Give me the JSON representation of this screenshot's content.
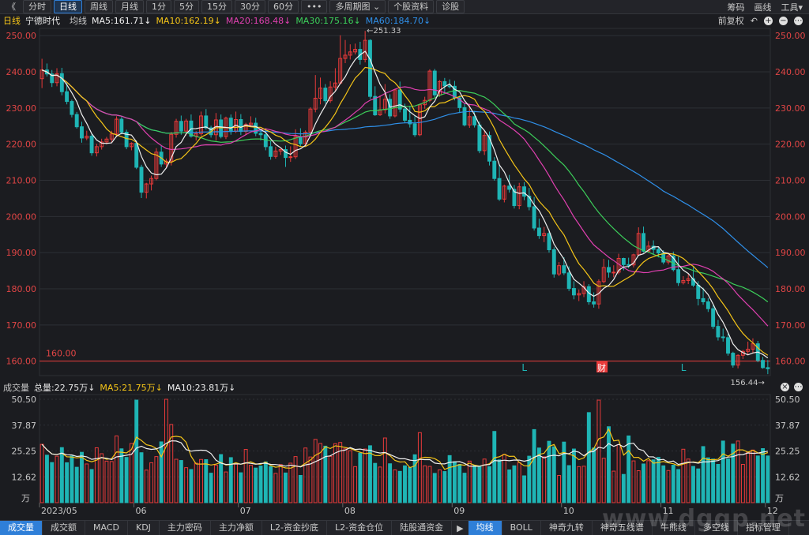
{
  "toolbar": {
    "back": "《",
    "buttons": [
      "分时",
      "日线",
      "周线",
      "月线",
      "1分",
      "5分",
      "15分",
      "30分",
      "60分",
      "•••",
      "多周期图 ⌄",
      "个股资料",
      "诊股"
    ],
    "active_index": 1,
    "right": [
      "筹码",
      "画线",
      "工具▾"
    ]
  },
  "legend": {
    "period": "日线",
    "stock": "宁德时代",
    "ma_label": "均线",
    "ma5": "MA5:161.71↓",
    "ma10": "MA10:162.19↓",
    "ma20": "MA20:168.48↓",
    "ma30": "MA30:175.16↓",
    "ma60": "MA60:184.70↓",
    "right_label": "前复权",
    "colors": {
      "ma5": "#f0f0f0",
      "ma10": "#f5c518",
      "ma20": "#e040b0",
      "ma30": "#3ccf5a",
      "ma60": "#2f8fe8"
    }
  },
  "volume_legend": {
    "label": "成交量",
    "total": "总量:22.75万↓",
    "ma5": "MA5:21.75万↓",
    "ma10": "MA10:23.81万↓"
  },
  "price_axis": {
    "labels": [
      "250.00",
      "240.00",
      "230.00",
      "220.00",
      "210.00",
      "200.00",
      "190.00",
      "180.00",
      "170.00",
      "160.00"
    ],
    "ref_line": "160.00",
    "high": "251.33",
    "low": "156.44"
  },
  "volume_axis": {
    "labels": [
      "50.50",
      "37.87",
      "25.25",
      "12.62",
      "万"
    ]
  },
  "markers": [
    "L",
    "财",
    "L"
  ],
  "x_labels": [
    "2023/05",
    "06",
    "07",
    "08",
    "09",
    "10",
    "11",
    "12"
  ],
  "bottom_tabs": [
    "成交量",
    "成交额",
    "MACD",
    "KDJ",
    "主力密码",
    "主力净额",
    "L2-资金抄底",
    "L2-资金仓位",
    "陆股通资金",
    "▶",
    "均线",
    "BOLL",
    "神奇九转",
    "神奇五线谱",
    "牛熊线",
    "多空线",
    "指标管理"
  ],
  "bottom_active": [
    0,
    10
  ],
  "watermark": "www.dgqp.net",
  "colors": {
    "up": "#e83a3a",
    "down": "#1fb5b5",
    "bg": "#1b1c20",
    "grid": "#2d2f35"
  },
  "chart_data": {
    "type": "candlestick",
    "title": "宁德时代 日线",
    "ylim": [
      156,
      252
    ],
    "volume_ylim": [
      0,
      50.5
    ],
    "candles": [
      [
        238.1,
        243.6,
        240.5,
        235.5,
        28.5
      ],
      [
        240.5,
        242.3,
        239.4,
        238.7,
        23.2
      ],
      [
        239.4,
        240.5,
        237.0,
        235.8,
        19.6
      ],
      [
        237.0,
        241.0,
        239.5,
        236.0,
        22.7
      ],
      [
        239.5,
        241.1,
        234.5,
        233.5,
        26.9
      ],
      [
        234.5,
        237.1,
        231.8,
        231.0,
        19.5
      ],
      [
        231.8,
        232.3,
        228.2,
        227.4,
        22.8
      ],
      [
        228.2,
        228.9,
        224.8,
        224.3,
        17.3
      ],
      [
        224.8,
        226.2,
        221.7,
        220.4,
        24.6
      ],
      [
        221.7,
        223.7,
        222.2,
        221.1,
        18.9
      ],
      [
        222.2,
        222.7,
        217.6,
        216.8,
        16.2
      ],
      [
        217.6,
        220.1,
        219.3,
        216.6,
        26.8
      ],
      [
        219.3,
        221.5,
        220.6,
        218.5,
        23.9
      ],
      [
        220.6,
        222.0,
        221.4,
        219.9,
        20.3
      ],
      [
        221.4,
        223.7,
        222.8,
        220.5,
        20.1
      ],
      [
        222.8,
        227.7,
        226.9,
        221.9,
        32.6
      ],
      [
        226.9,
        227.5,
        223.3,
        222.7,
        26.3
      ],
      [
        223.3,
        224.0,
        219.3,
        218.6,
        22.1
      ],
      [
        219.3,
        220.5,
        220.2,
        218.3,
        28.9
      ],
      [
        220.2,
        221.0,
        213.6,
        213.1,
        50.1
      ],
      [
        213.6,
        214.3,
        206.7,
        205.1,
        24.4
      ],
      [
        206.7,
        209.3,
        209.0,
        205.0,
        15.9
      ],
      [
        209.0,
        211.3,
        210.5,
        207.2,
        19.5
      ],
      [
        210.5,
        218.9,
        217.8,
        210.0,
        22.5
      ],
      [
        217.8,
        219.5,
        214.5,
        213.7,
        29.7
      ],
      [
        214.5,
        216.0,
        215.3,
        213.6,
        50.5
      ],
      [
        215.3,
        223.4,
        222.7,
        214.1,
        38.2
      ],
      [
        222.7,
        227.0,
        226.3,
        221.8,
        21.2
      ],
      [
        226.3,
        227.9,
        223.6,
        222.6,
        20.6
      ],
      [
        223.6,
        227.0,
        226.4,
        222.4,
        17.1
      ],
      [
        226.4,
        228.2,
        222.2,
        221.8,
        16.2
      ],
      [
        222.2,
        223.6,
        222.9,
        221.0,
        19.3
      ],
      [
        222.9,
        229.0,
        227.8,
        222.3,
        21.1
      ],
      [
        227.8,
        229.7,
        224.5,
        224.0,
        21.0
      ],
      [
        224.5,
        225.1,
        222.6,
        221.8,
        14.4
      ],
      [
        222.6,
        228.6,
        226.7,
        221.0,
        18.3
      ],
      [
        226.7,
        228.2,
        222.1,
        221.6,
        23.5
      ],
      [
        222.1,
        227.6,
        227.2,
        221.4,
        15.0
      ],
      [
        227.2,
        228.2,
        223.5,
        222.6,
        22.0
      ],
      [
        223.5,
        229.0,
        226.8,
        223.1,
        18.8
      ],
      [
        226.8,
        228.3,
        223.5,
        222.5,
        14.6
      ],
      [
        223.5,
        225.9,
        225.4,
        222.7,
        26.0
      ],
      [
        225.4,
        227.7,
        225.8,
        224.8,
        18.3
      ],
      [
        225.8,
        227.3,
        223.0,
        222.2,
        16.9
      ],
      [
        223.0,
        224.1,
        222.6,
        221.0,
        17.9
      ],
      [
        222.6,
        224.4,
        219.3,
        218.3,
        19.9
      ],
      [
        219.3,
        220.8,
        216.6,
        215.7,
        17.6
      ],
      [
        216.6,
        219.3,
        218.1,
        216.0,
        14.3
      ],
      [
        218.1,
        218.8,
        218.5,
        217.0,
        18.6
      ],
      [
        218.5,
        219.6,
        216.3,
        213.7,
        14.5
      ],
      [
        216.3,
        219.4,
        216.5,
        215.1,
        19.3
      ],
      [
        216.5,
        224.1,
        222.1,
        215.9,
        22.5
      ],
      [
        222.1,
        224.4,
        220.1,
        219.4,
        13.3
      ],
      [
        220.1,
        223.8,
        223.3,
        219.8,
        26.7
      ],
      [
        223.3,
        230.2,
        229.7,
        222.5,
        22.3
      ],
      [
        229.7,
        239.1,
        232.7,
        228.8,
        30.9
      ],
      [
        232.7,
        238.4,
        235.5,
        231.0,
        28.9
      ],
      [
        235.5,
        236.6,
        232.0,
        231.2,
        27.6
      ],
      [
        232.0,
        237.4,
        235.8,
        231.4,
        22.6
      ],
      [
        235.8,
        241.0,
        236.9,
        234.7,
        28.8
      ],
      [
        236.9,
        250.1,
        243.7,
        236.5,
        29.4
      ],
      [
        243.7,
        248.8,
        244.6,
        242.4,
        26.3
      ],
      [
        244.6,
        247.6,
        245.5,
        243.4,
        25.4
      ],
      [
        245.5,
        247.8,
        246.2,
        244.8,
        17.6
      ],
      [
        246.2,
        248.3,
        243.4,
        242.0,
        24.2
      ],
      [
        243.4,
        251.3,
        248.7,
        242.6,
        26.2
      ],
      [
        248.7,
        249.0,
        233.2,
        232.5,
        27.8
      ],
      [
        233.2,
        236.0,
        228.1,
        227.8,
        19.2
      ],
      [
        228.1,
        233.5,
        229.5,
        227.8,
        17.4
      ],
      [
        229.5,
        236.6,
        232.4,
        228.5,
        31.6
      ],
      [
        232.4,
        233.8,
        227.8,
        227.0,
        19.0
      ],
      [
        227.8,
        235.3,
        235.0,
        227.4,
        16.0
      ],
      [
        235.0,
        237.3,
        229.7,
        228.8,
        15.3
      ],
      [
        229.7,
        231.2,
        226.6,
        225.8,
        18.0
      ],
      [
        226.6,
        230.6,
        225.6,
        224.6,
        17.2
      ],
      [
        225.6,
        227.7,
        222.6,
        222.0,
        23.4
      ],
      [
        222.6,
        231.2,
        230.9,
        222.2,
        34.2
      ],
      [
        230.9,
        233.1,
        232.1,
        229.8,
        18.0
      ],
      [
        232.1,
        240.7,
        240.2,
        231.6,
        17.7
      ],
      [
        240.2,
        240.8,
        233.6,
        233.0,
        14.3
      ],
      [
        233.6,
        237.7,
        237.3,
        233.1,
        16.0
      ],
      [
        237.3,
        238.3,
        236.1,
        234.1,
        15.2
      ],
      [
        236.1,
        237.9,
        236.0,
        235.4,
        23.0
      ],
      [
        236.0,
        237.5,
        232.8,
        232.1,
        20.0
      ],
      [
        232.8,
        233.4,
        230.1,
        228.6,
        18.7
      ],
      [
        230.1,
        231.4,
        225.3,
        224.9,
        14.4
      ],
      [
        225.3,
        231.1,
        227.6,
        224.5,
        20.3
      ],
      [
        227.6,
        229.2,
        225.3,
        224.6,
        18.2
      ],
      [
        225.3,
        226.3,
        218.2,
        217.5,
        17.6
      ],
      [
        218.2,
        223.7,
        222.4,
        217.0,
        21.3
      ],
      [
        222.4,
        223.5,
        215.3,
        214.1,
        17.6
      ],
      [
        215.3,
        216.4,
        210.5,
        209.9,
        34.8
      ],
      [
        210.5,
        214.4,
        204.8,
        204.3,
        20.9
      ],
      [
        204.8,
        208.8,
        208.4,
        203.9,
        23.6
      ],
      [
        208.4,
        211.5,
        207.5,
        206.6,
        16.0
      ],
      [
        207.5,
        208.7,
        203.0,
        202.2,
        18.0
      ],
      [
        203.0,
        209.3,
        208.2,
        202.0,
        19.6
      ],
      [
        208.2,
        209.5,
        205.6,
        204.5,
        13.1
      ],
      [
        205.6,
        207.9,
        202.7,
        201.7,
        22.7
      ],
      [
        202.7,
        205.4,
        196.8,
        196.1,
        35.7
      ],
      [
        196.8,
        199.4,
        194.7,
        193.8,
        26.7
      ],
      [
        194.7,
        197.1,
        195.3,
        192.9,
        22.4
      ],
      [
        195.3,
        196.4,
        190.8,
        190.0,
        30.0
      ],
      [
        190.8,
        191.5,
        184.1,
        183.1,
        27.3
      ],
      [
        184.1,
        187.4,
        186.4,
        183.5,
        13.3
      ],
      [
        186.4,
        188.7,
        184.4,
        183.8,
        29.6
      ],
      [
        184.4,
        186.2,
        180.1,
        179.4,
        18.1
      ],
      [
        180.1,
        182.1,
        178.3,
        177.1,
        26.2
      ],
      [
        178.3,
        179.8,
        178.7,
        176.6,
        17.6
      ],
      [
        178.7,
        182.1,
        180.6,
        177.7,
        17.8
      ],
      [
        180.6,
        181.3,
        176.4,
        175.6,
        44.0
      ],
      [
        176.4,
        179.0,
        175.8,
        174.8,
        26.7
      ],
      [
        175.8,
        182.6,
        182.0,
        174.5,
        50.1
      ],
      [
        182.0,
        188.3,
        185.9,
        181.5,
        21.7
      ],
      [
        185.9,
        188.0,
        184.6,
        183.1,
        37.1
      ],
      [
        184.6,
        186.5,
        184.6,
        183.2,
        15.4
      ],
      [
        184.6,
        189.7,
        188.4,
        184.0,
        28.3
      ],
      [
        188.4,
        188.6,
        186.7,
        185.1,
        13.8
      ],
      [
        186.7,
        188.6,
        186.6,
        185.7,
        32.6
      ],
      [
        186.6,
        189.7,
        189.4,
        185.9,
        20.4
      ],
      [
        189.4,
        197.0,
        195.3,
        189.2,
        15.6
      ],
      [
        195.3,
        197.2,
        190.4,
        190.0,
        18.9
      ],
      [
        190.4,
        193.2,
        191.8,
        189.9,
        20.5
      ],
      [
        191.8,
        193.4,
        190.9,
        189.6,
        20.9
      ],
      [
        190.9,
        191.5,
        189.9,
        188.7,
        22.1
      ],
      [
        189.9,
        190.7,
        187.4,
        186.8,
        18.0
      ],
      [
        187.4,
        189.9,
        189.1,
        186.7,
        15.7
      ],
      [
        189.1,
        190.3,
        185.3,
        184.8,
        18.3
      ],
      [
        185.3,
        188.9,
        181.7,
        180.8,
        16.2
      ],
      [
        181.7,
        183.5,
        182.3,
        181.2,
        26.1
      ],
      [
        182.3,
        184.2,
        182.8,
        181.3,
        21.3
      ],
      [
        182.8,
        186.0,
        181.0,
        180.5,
        17.7
      ],
      [
        181.0,
        182.1,
        177.3,
        175.4,
        16.5
      ],
      [
        177.3,
        180.3,
        176.4,
        175.6,
        27.4
      ],
      [
        176.4,
        177.4,
        174.5,
        173.6,
        21.9
      ],
      [
        174.5,
        175.4,
        169.6,
        168.9,
        21.3
      ],
      [
        169.6,
        171.4,
        166.7,
        165.7,
        18.7
      ],
      [
        166.7,
        169.0,
        166.5,
        165.4,
        30.1
      ],
      [
        166.5,
        167.6,
        162.2,
        161.5,
        21.4
      ],
      [
        162.2,
        162.6,
        158.9,
        158.2,
        28.6
      ],
      [
        158.9,
        161.9,
        161.6,
        158.0,
        30.1
      ],
      [
        161.6,
        163.1,
        162.7,
        160.6,
        18.7
      ],
      [
        162.7,
        165.4,
        163.3,
        161.7,
        24.6
      ],
      [
        163.3,
        166.3,
        164.8,
        162.3,
        25.7
      ],
      [
        164.8,
        165.6,
        160.2,
        159.7,
        22.8
      ],
      [
        160.2,
        161.2,
        158.2,
        157.9,
        26.4
      ],
      [
        158.2,
        160.3,
        157.9,
        156.4,
        22.8
      ]
    ],
    "volume_unit": "万",
    "y_ticks": [
      250,
      240,
      230,
      220,
      210,
      200,
      190,
      180,
      170,
      160
    ]
  }
}
